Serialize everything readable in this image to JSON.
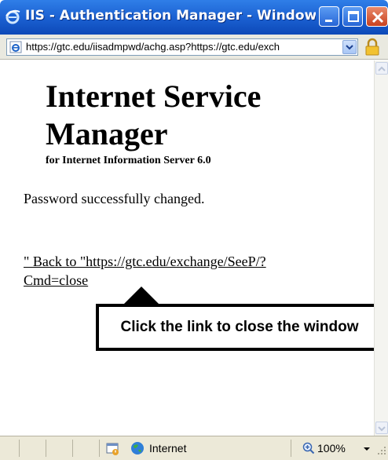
{
  "window": {
    "title": "IIS - Authentication Manager - Windows ...",
    "icon": "ie-icon",
    "controls": [
      "minimize-icon",
      "maximize-icon",
      "close-icon"
    ]
  },
  "address_bar": {
    "url": "https://gtc.edu/iisadmpwd/achg.asp?https://gtc.edu/exch",
    "icons": [
      "ie-page-icon",
      "dropdown-arrow-icon",
      "lock-icon"
    ]
  },
  "page": {
    "heading": "Internet Service Manager",
    "subheading": "for Internet Information Server 6.0",
    "message": "Password successfully changed.",
    "back_link": "\" Back to \"https://gtc.edu/exchange/SeeP/?Cmd=close"
  },
  "annotation": {
    "callout_text": "Click the link to close the window"
  },
  "status_bar": {
    "zone": "Internet",
    "zoom": "100%",
    "icons": [
      "protected-mode-icon",
      "globe-icon",
      "zoom-icon",
      "zoom-dropdown-icon",
      "resize-grip-icon"
    ]
  },
  "colors": {
    "titlebar": "#1a5fd0",
    "close_button": "#c8411f",
    "chrome": "#ece9d8"
  }
}
